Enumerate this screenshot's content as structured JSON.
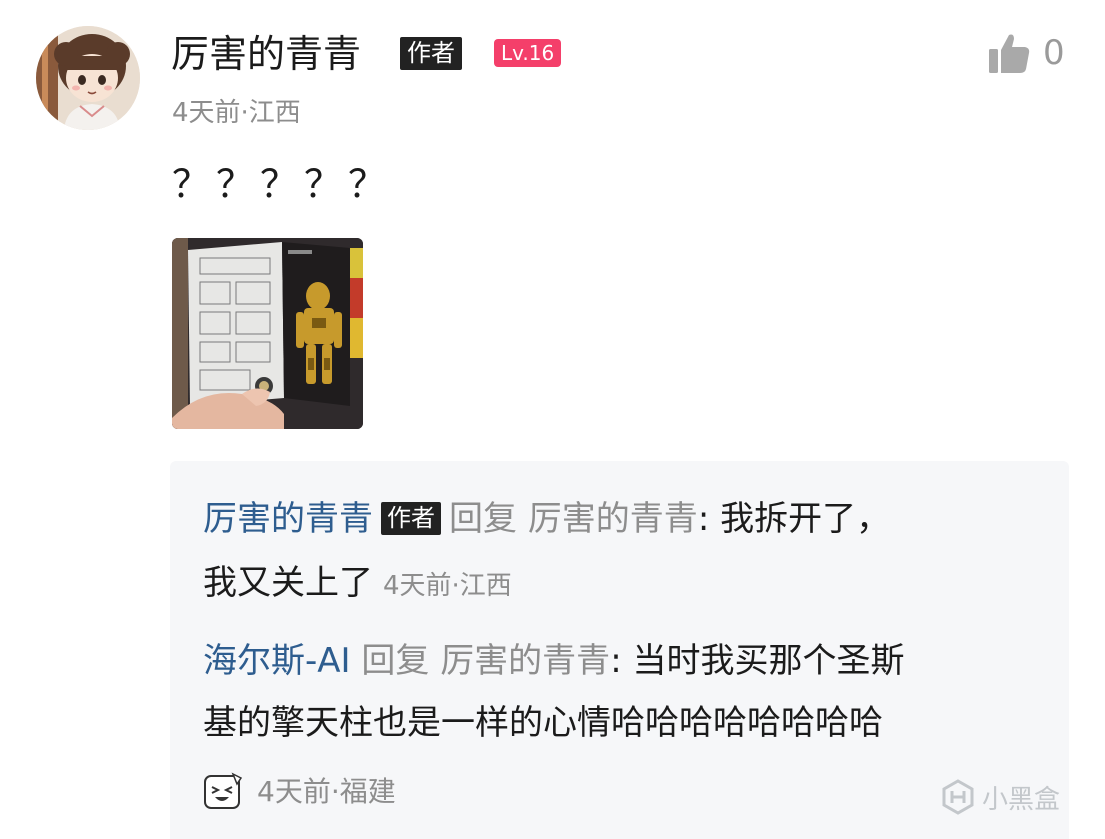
{
  "comment": {
    "username": "厉害的青青",
    "author_tag": "作者",
    "level_tag": "Lv.16",
    "time_location": "4天前·江西",
    "text": "？？？？？",
    "like_count": "0"
  },
  "replies": [
    {
      "name": "厉害的青青",
      "author_tag": "作者",
      "verb": "回复",
      "target": "厉害的青青",
      "text_line1": ": 我拆开了，",
      "text_line2": "我又关上了",
      "time_location": "4天前·江西"
    },
    {
      "name": "海尔斯-AI",
      "verb": "回复",
      "target": "厉害的青青",
      "text_line1": ": 当时我买那个圣斯",
      "text_line2": "基的擎天柱也是一样的心情哈哈哈哈哈哈哈哈"
    }
  ],
  "footer": {
    "time_location": "4天前·福建"
  },
  "watermark": {
    "text": "小黑盒"
  },
  "icons": {
    "like": "thumbs-up-icon",
    "footer_emoji": "laughing-face-icon",
    "watermark_logo": "heybox-logo-icon"
  },
  "colors": {
    "level_tag": "#f43f6a",
    "reply_name": "#2e5d8f",
    "reply_bg": "#f6f7f9",
    "muted_text": "#8d8d8d"
  }
}
